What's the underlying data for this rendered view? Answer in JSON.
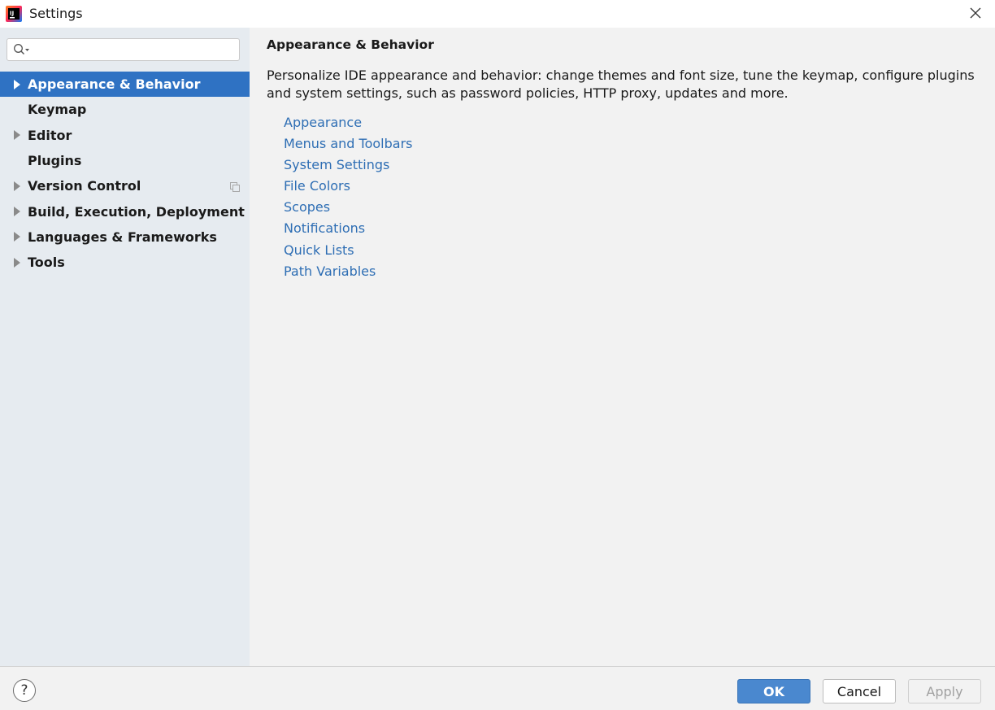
{
  "window": {
    "title": "Settings",
    "app_icon": "intellij-idea-icon",
    "close_icon": "close-icon"
  },
  "search": {
    "placeholder": "",
    "value": "",
    "icon": "search-icon"
  },
  "sidebar": {
    "items": [
      {
        "label": "Appearance & Behavior",
        "expandable": true,
        "selected": true
      },
      {
        "label": "Keymap",
        "expandable": false,
        "selected": false
      },
      {
        "label": "Editor",
        "expandable": true,
        "selected": false
      },
      {
        "label": "Plugins",
        "expandable": false,
        "selected": false
      },
      {
        "label": "Version Control",
        "expandable": true,
        "selected": false,
        "project_icon": "copy-icon"
      },
      {
        "label": "Build, Execution, Deployment",
        "expandable": true,
        "selected": false
      },
      {
        "label": "Languages & Frameworks",
        "expandable": true,
        "selected": false
      },
      {
        "label": "Tools",
        "expandable": true,
        "selected": false
      }
    ]
  },
  "main": {
    "title": "Appearance & Behavior",
    "description": "Personalize IDE appearance and behavior: change themes and font size, tune the keymap, configure plugins and system settings, such as password policies, HTTP proxy, updates and more.",
    "links": [
      "Appearance",
      "Menus and Toolbars",
      "System Settings",
      "File Colors",
      "Scopes",
      "Notifications",
      "Quick Lists",
      "Path Variables"
    ]
  },
  "footer": {
    "help_label": "?",
    "ok_label": "OK",
    "cancel_label": "Cancel",
    "apply_label": "Apply"
  },
  "colors": {
    "selection": "#2f72c3",
    "link": "#2e6eb4",
    "sidebar_bg": "#e6ebf0",
    "ok_button": "#4a88cf"
  }
}
